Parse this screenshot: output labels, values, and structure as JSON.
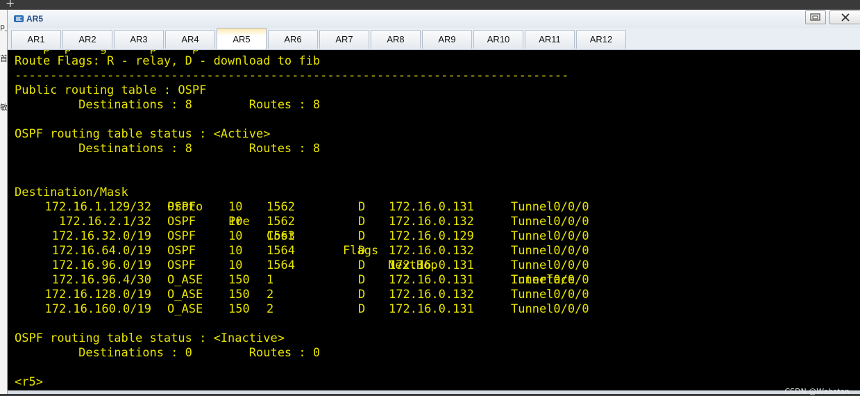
{
  "window": {
    "title": "AR5"
  },
  "left_strip": {
    "glyphs": [
      "p_",
      "首",
      "敏"
    ]
  },
  "tabs": [
    {
      "label": "AR1"
    },
    {
      "label": "AR2"
    },
    {
      "label": "AR3"
    },
    {
      "label": "AR4"
    },
    {
      "label": "AR5",
      "active": true
    },
    {
      "label": "AR6"
    },
    {
      "label": "AR7"
    },
    {
      "label": "AR8"
    },
    {
      "label": "AR9"
    },
    {
      "label": "AR10"
    },
    {
      "label": "AR11"
    },
    {
      "label": "AR12"
    }
  ],
  "terminal": {
    "color": "#e6e300",
    "ghost_line": "    p  p    g      p     p",
    "flags_line": "Route Flags: R - relay, D - download to fib",
    "separator": "------------------------------------------------------------------------------",
    "public_header": "Public routing table : OSPF",
    "public_counts": "         Destinations : 8        Routes : 8",
    "active_header": "OSPF routing table status : <Active>",
    "active_counts": "         Destinations : 8        Routes : 8",
    "columns": {
      "dest": "Destination/Mask",
      "proto": "Proto",
      "pre": "Pre",
      "cost": "Cost",
      "flags": "Flags",
      "nexthop": "NextHop",
      "interface": "Interface"
    },
    "routes": [
      {
        "dest": "172.16.1.129/32",
        "proto": "OSPF",
        "pre": "10",
        "cost": "1562",
        "flags": "D",
        "nexthop": "172.16.0.131",
        "interface": "Tunnel0/0/0"
      },
      {
        "dest": "172.16.2.1/32",
        "proto": "OSPF",
        "pre": "10",
        "cost": "1562",
        "flags": "D",
        "nexthop": "172.16.0.132",
        "interface": "Tunnel0/0/0"
      },
      {
        "dest": "172.16.32.0/19",
        "proto": "OSPF",
        "pre": "10",
        "cost": "1563",
        "flags": "D",
        "nexthop": "172.16.0.129",
        "interface": "Tunnel0/0/0"
      },
      {
        "dest": "172.16.64.0/19",
        "proto": "OSPF",
        "pre": "10",
        "cost": "1564",
        "flags": "D",
        "nexthop": "172.16.0.132",
        "interface": "Tunnel0/0/0"
      },
      {
        "dest": "172.16.96.0/19",
        "proto": "OSPF",
        "pre": "10",
        "cost": "1564",
        "flags": "D",
        "nexthop": "172.16.0.131",
        "interface": "Tunnel0/0/0"
      },
      {
        "dest": "172.16.96.4/30",
        "proto": "O_ASE",
        "pre": "150",
        "cost": "1",
        "flags": "D",
        "nexthop": "172.16.0.131",
        "interface": "Tunnel0/0/0"
      },
      {
        "dest": "172.16.128.0/19",
        "proto": "O_ASE",
        "pre": "150",
        "cost": "2",
        "flags": "D",
        "nexthop": "172.16.0.132",
        "interface": "Tunnel0/0/0"
      },
      {
        "dest": "172.16.160.0/19",
        "proto": "O_ASE",
        "pre": "150",
        "cost": "2",
        "flags": "D",
        "nexthop": "172.16.0.131",
        "interface": "Tunnel0/0/0"
      }
    ],
    "inactive_header": "OSPF routing table status : <Inactive>",
    "inactive_counts": "         Destinations : 0        Routes : 0",
    "prompt": "<r5>"
  },
  "watermark": "CSDN @Webston"
}
